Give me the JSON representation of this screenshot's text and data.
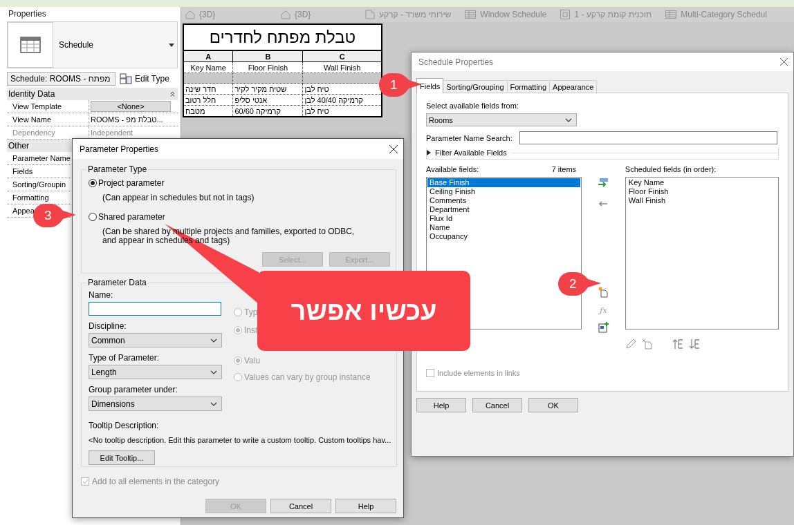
{
  "view_tabs": [
    {
      "label": "{3D}",
      "kind": "house"
    },
    {
      "label": "{3D}",
      "kind": "house"
    },
    {
      "label": "שירותי משרד - קרקע",
      "kind": "plan"
    },
    {
      "label": "Window Schedule",
      "kind": "schedule"
    },
    {
      "label": "תוכנית קומת קרקע - 1",
      "kind": "floor"
    },
    {
      "label": "Multi-Category Schedul",
      "kind": "schedule"
    }
  ],
  "properties": {
    "title": "Properties",
    "type_name": "Schedule",
    "selector": "Schedule: ROOMS - מפתח",
    "edit_type": "Edit Type",
    "groups": [
      {
        "name": "Identity Data",
        "collapsible": true,
        "rows": [
          {
            "label": "View Template",
            "value": "<None>",
            "kind": "button",
            "disabled": false
          },
          {
            "label": "View Name",
            "value": "ROOMS - טבלת מפ...",
            "kind": "text",
            "disabled": false
          },
          {
            "label": "Dependency",
            "value": "Independent",
            "kind": "text",
            "disabled": true
          }
        ]
      },
      {
        "name": "Other",
        "rows": [
          {
            "label": "Parameter Name",
            "kind": "label",
            "disabled": false
          },
          {
            "label": "Fields",
            "kind": "label",
            "disabled": false
          },
          {
            "label": "Sorting/Groupin",
            "kind": "label",
            "disabled": false
          },
          {
            "label": "Formatting",
            "kind": "label",
            "disabled": false
          },
          {
            "label": "Appea",
            "kind": "label",
            "disabled": false
          }
        ]
      }
    ]
  },
  "schedule": {
    "title": "טבלת מפתח לחדרים",
    "letters": [
      "A",
      "B",
      "C"
    ],
    "columns": [
      "Key Name",
      "Floor Finish",
      "Wall Finish"
    ],
    "rows": [
      [
        "חדר שינה",
        "שטיח מקיר לקיר",
        "טיח לבן"
      ],
      [
        "חלל רטוב",
        "אנטי סליפ",
        "קרמיקה 40/40 לבן"
      ],
      [
        "מטבח",
        "קרמיקה 60/60",
        "טיח לבן"
      ]
    ]
  },
  "schedule_properties": {
    "title": "Schedule Properties",
    "tabs": [
      {
        "label": "Fields",
        "selected": true
      },
      {
        "label": "Sorting/Grouping",
        "selected": false
      },
      {
        "label": "Formatting",
        "selected": false
      },
      {
        "label": "Appearance",
        "selected": false
      }
    ],
    "source_label": "Select available fields from:",
    "source_value": "Rooms",
    "search_label": "Parameter Name Search:",
    "filter_label": "Filter Available Fields",
    "available_label": "Available fields:",
    "available_count": "7 items",
    "available": [
      {
        "label": "Base Finish",
        "selected": true
      },
      {
        "label": "Ceiling Finish",
        "selected": false
      },
      {
        "label": "Comments",
        "selected": false
      },
      {
        "label": "Department",
        "selected": false
      },
      {
        "label": "Flux Id",
        "selected": false
      },
      {
        "label": "Name",
        "selected": false
      },
      {
        "label": "Occupancy",
        "selected": false
      }
    ],
    "scheduled_label": "Scheduled fields (in order):",
    "scheduled": [
      "Key Name",
      "Floor Finish",
      "Wall Finish"
    ],
    "include_links": {
      "label": "Include elements in links",
      "checked": false
    },
    "buttons": [
      "Help",
      "Cancel",
      "OK"
    ]
  },
  "parameter_properties": {
    "title": "Parameter Properties",
    "type_group": "Parameter Type",
    "options": [
      {
        "label": "Project parameter",
        "note": "(Can appear in schedules but not in tags)",
        "selected": true
      },
      {
        "label": "Shared parameter",
        "note": "(Can be shared by multiple projects and families, exported to ODBC, and appear in schedules and tags)",
        "selected": false
      }
    ],
    "shared_buttons": [
      {
        "label": "Select...",
        "disabled": true
      },
      {
        "label": "Export...",
        "disabled": true
      }
    ],
    "data_group": "Parameter Data",
    "name_label": "Name:",
    "dropdowns": [
      {
        "label": "Discipline:",
        "value": "Common"
      },
      {
        "label": "Type of Parameter:",
        "value": "Length"
      },
      {
        "label": "Group parameter under:",
        "value": "Dimensions"
      }
    ],
    "radios": [
      {
        "label": "Typ",
        "selected": false
      },
      {
        "label": "Inst",
        "selected": true
      },
      {
        "label": "Valu",
        "selected": true
      },
      {
        "label": "Values can vary by group instance",
        "selected": false
      }
    ],
    "tooltip_label": "Tooltip Description:",
    "tooltip_text": "<No tooltip description. Edit this parameter to write a custom tooltip. Custom tooltips hav...",
    "edit_tooltip": "Edit Tooltip...",
    "add_all": {
      "label": "Add to all elements in the category",
      "checked": true
    },
    "buttons": [
      {
        "label": "OK",
        "disabled": true
      },
      {
        "label": "Cancel",
        "disabled": false
      },
      {
        "label": "Help",
        "disabled": false
      }
    ]
  },
  "formula_button": "ƒx",
  "callouts": [
    "1",
    "2",
    "3"
  ],
  "banner": "עכשיו אפשר"
}
